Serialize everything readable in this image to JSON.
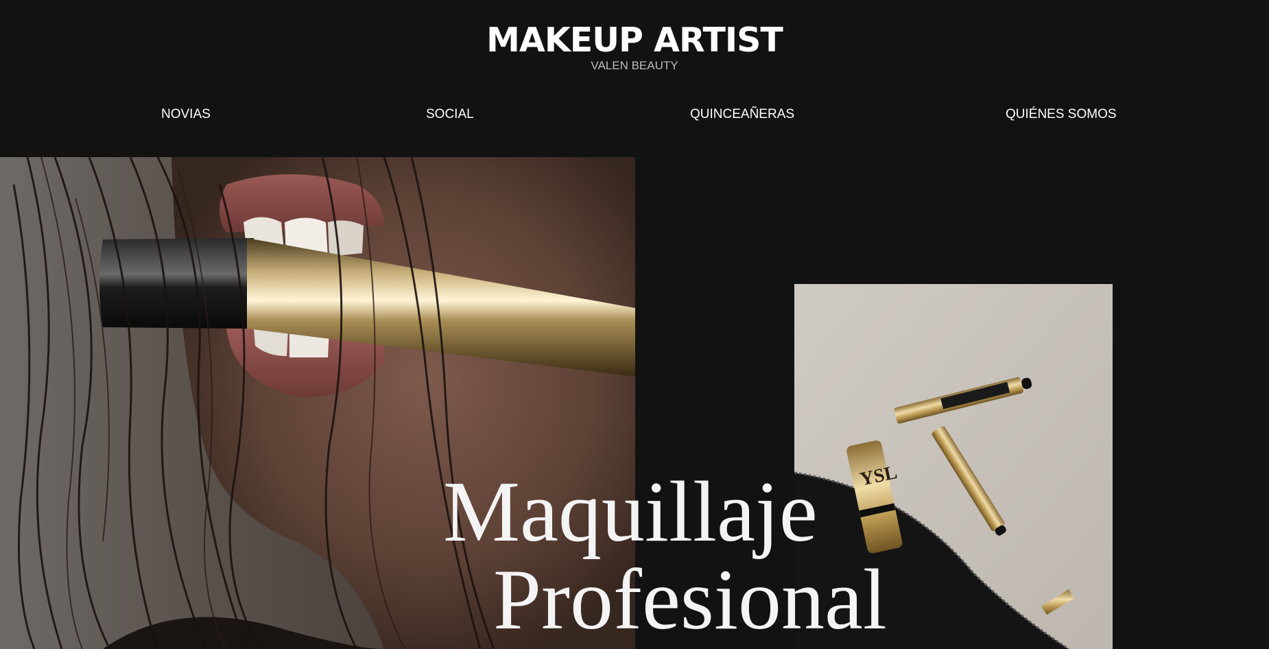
{
  "header": {
    "title": "MAKEUP ARTIST",
    "subtitle": "VALEN BEAUTY"
  },
  "nav": {
    "items": [
      {
        "label": "NOVIAS"
      },
      {
        "label": "SOCIAL"
      },
      {
        "label": "QUINCEAÑERAS"
      },
      {
        "label": "QUIÉNES SOMOS"
      }
    ]
  },
  "hero": {
    "headline_line1": "Maquillaje",
    "headline_line2": "Profesional"
  },
  "colors": {
    "background": "#121212",
    "text": "#ffffff",
    "subtitle": "#bdbdbd",
    "gold": "#c9a86a"
  }
}
